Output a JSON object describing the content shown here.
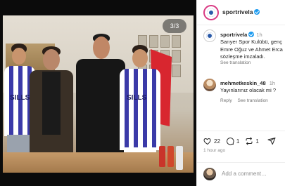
{
  "photo": {
    "counter": "3/3",
    "jersey_text": "SILLS"
  },
  "header": {
    "username": "sportrivela"
  },
  "caption": {
    "username": "sportrivela",
    "time": "1h",
    "lines": [
      "Sarıyer Spor Kulübü, genç",
      "Emre Oğuz ve Ahmet Erca",
      "sözleşme imzaladı."
    ],
    "see_translation": "See translation"
  },
  "comment": {
    "username": "mehmetkeskin_48",
    "time": "1h",
    "text": "Yayınlarınız olacak mi ?",
    "reply": "Reply",
    "see_translation": "See translation"
  },
  "actions": {
    "likes": "22",
    "comments": "1",
    "reposts": "1",
    "time_ago": "1 hour ago"
  },
  "add_comment": {
    "placeholder": "Add a comment…"
  },
  "colors": {
    "verified": "#1d9bf0",
    "jersey_blue": "#3b3aa8",
    "flag_red": "#d8262f"
  }
}
